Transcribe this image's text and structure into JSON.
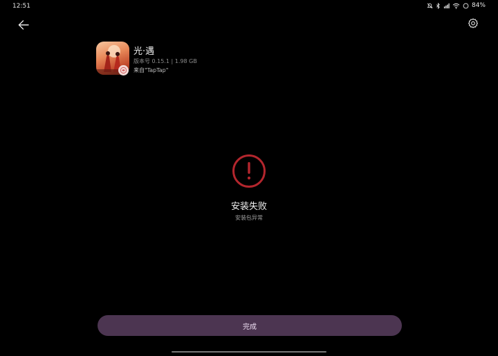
{
  "status_bar": {
    "time": "12:51",
    "battery_percent": "84%",
    "icons": [
      "bell-off-icon",
      "bluetooth-icon",
      "signal-icon",
      "wifi-icon",
      "battery-icon"
    ]
  },
  "toolbar": {
    "back_icon": "arrow-left-icon",
    "settings_icon": "gear-icon"
  },
  "app": {
    "name": "光·遇",
    "meta": "版本号 0.15.1 | 1.98 GB",
    "source": "来自\"TapTap\""
  },
  "result": {
    "icon": "error-circle-icon",
    "title": "安装失败",
    "subtitle": "安装包异常",
    "accent_color": "#b3262d"
  },
  "actions": {
    "done_label": "完成",
    "button_color": "#4c3551"
  }
}
